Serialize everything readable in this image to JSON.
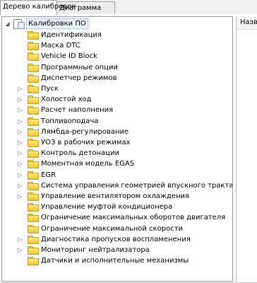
{
  "tabs": [
    {
      "label": "Дерево калибровок"
    },
    {
      "label": "Диаграмма"
    }
  ],
  "tree": {
    "root": {
      "label": "Калибровки ПО",
      "expanded": true,
      "expander": "◢"
    },
    "items": [
      {
        "label": "Идентификация",
        "expander": ""
      },
      {
        "label": "Маска DTC",
        "expander": ""
      },
      {
        "label": "Vehicle ID Block",
        "expander": ""
      },
      {
        "label": "Программные опции",
        "expander": ""
      },
      {
        "label": "Диспетчер режимов",
        "expander": ""
      },
      {
        "label": "Пуск",
        "expander": "▷"
      },
      {
        "label": "Холостой ход",
        "expander": "▷"
      },
      {
        "label": "Расчет наполнения",
        "expander": "▷"
      },
      {
        "label": "Топливоподача",
        "expander": "▷"
      },
      {
        "label": "Лямбда-регулирование",
        "expander": "▷"
      },
      {
        "label": "УОЗ в рабочих режимах",
        "expander": "▷"
      },
      {
        "label": "Контроль детонации",
        "expander": "▷"
      },
      {
        "label": "Моментная модель EGAS",
        "expander": "▷"
      },
      {
        "label": "EGR",
        "expander": "▷"
      },
      {
        "label": "Система управления геометрией впускного тракта",
        "expander": "▷"
      },
      {
        "label": "Управление вентилятором охлаждения",
        "expander": "▷"
      },
      {
        "label": "Управление муфтой кондиционера",
        "expander": ""
      },
      {
        "label": "Ограничение максимальных оборотов двигателя",
        "expander": ""
      },
      {
        "label": "Ограничение максимальной скорости",
        "expander": ""
      },
      {
        "label": "Диагностика пропусков воспламенения",
        "expander": "▷"
      },
      {
        "label": "Мониторинг нейтрализатора",
        "expander": "▷"
      },
      {
        "label": "Датчики и исполнительные механизмы",
        "expander": ""
      }
    ]
  },
  "right_panel": {
    "column_header": "Назва"
  },
  "colors": {
    "folder": "#f3c623",
    "selection": "#eef2fb"
  }
}
